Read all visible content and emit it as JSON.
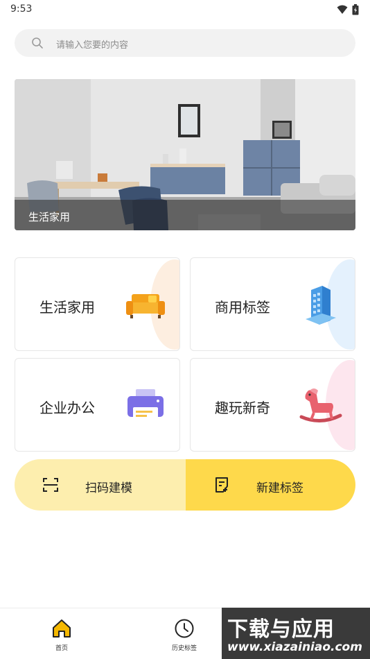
{
  "status": {
    "time": "9:53"
  },
  "search": {
    "placeholder": "请输入您要的内容"
  },
  "banner": {
    "caption": "生活家用"
  },
  "categories": [
    {
      "label": "生活家用",
      "icon": "sofa-icon",
      "tint": "#fdeee0"
    },
    {
      "label": "商用标签",
      "icon": "building-icon",
      "tint": "#e4f1fd"
    },
    {
      "label": "企业办公",
      "icon": "printer-icon",
      "tint": "#ffffff"
    },
    {
      "label": "趣玩新奇",
      "icon": "rocking-horse-icon",
      "tint": "#fde6ee"
    }
  ],
  "actions": {
    "scan": {
      "label": "扫码建模",
      "icon": "scan-icon"
    },
    "new_tag": {
      "label": "新建标签",
      "icon": "note-add-icon"
    }
  },
  "tabbar": {
    "items": [
      {
        "label": "首页",
        "icon": "home-icon",
        "active": true
      },
      {
        "label": "历史标签",
        "icon": "clock-icon",
        "active": false
      }
    ]
  },
  "watermark": {
    "line1": "下载与应用",
    "line2": "www.xiazainiao.com"
  },
  "colors": {
    "accent": "#fed94b",
    "accent_light": "#fdeeae",
    "active_icon": "#f5b800"
  }
}
